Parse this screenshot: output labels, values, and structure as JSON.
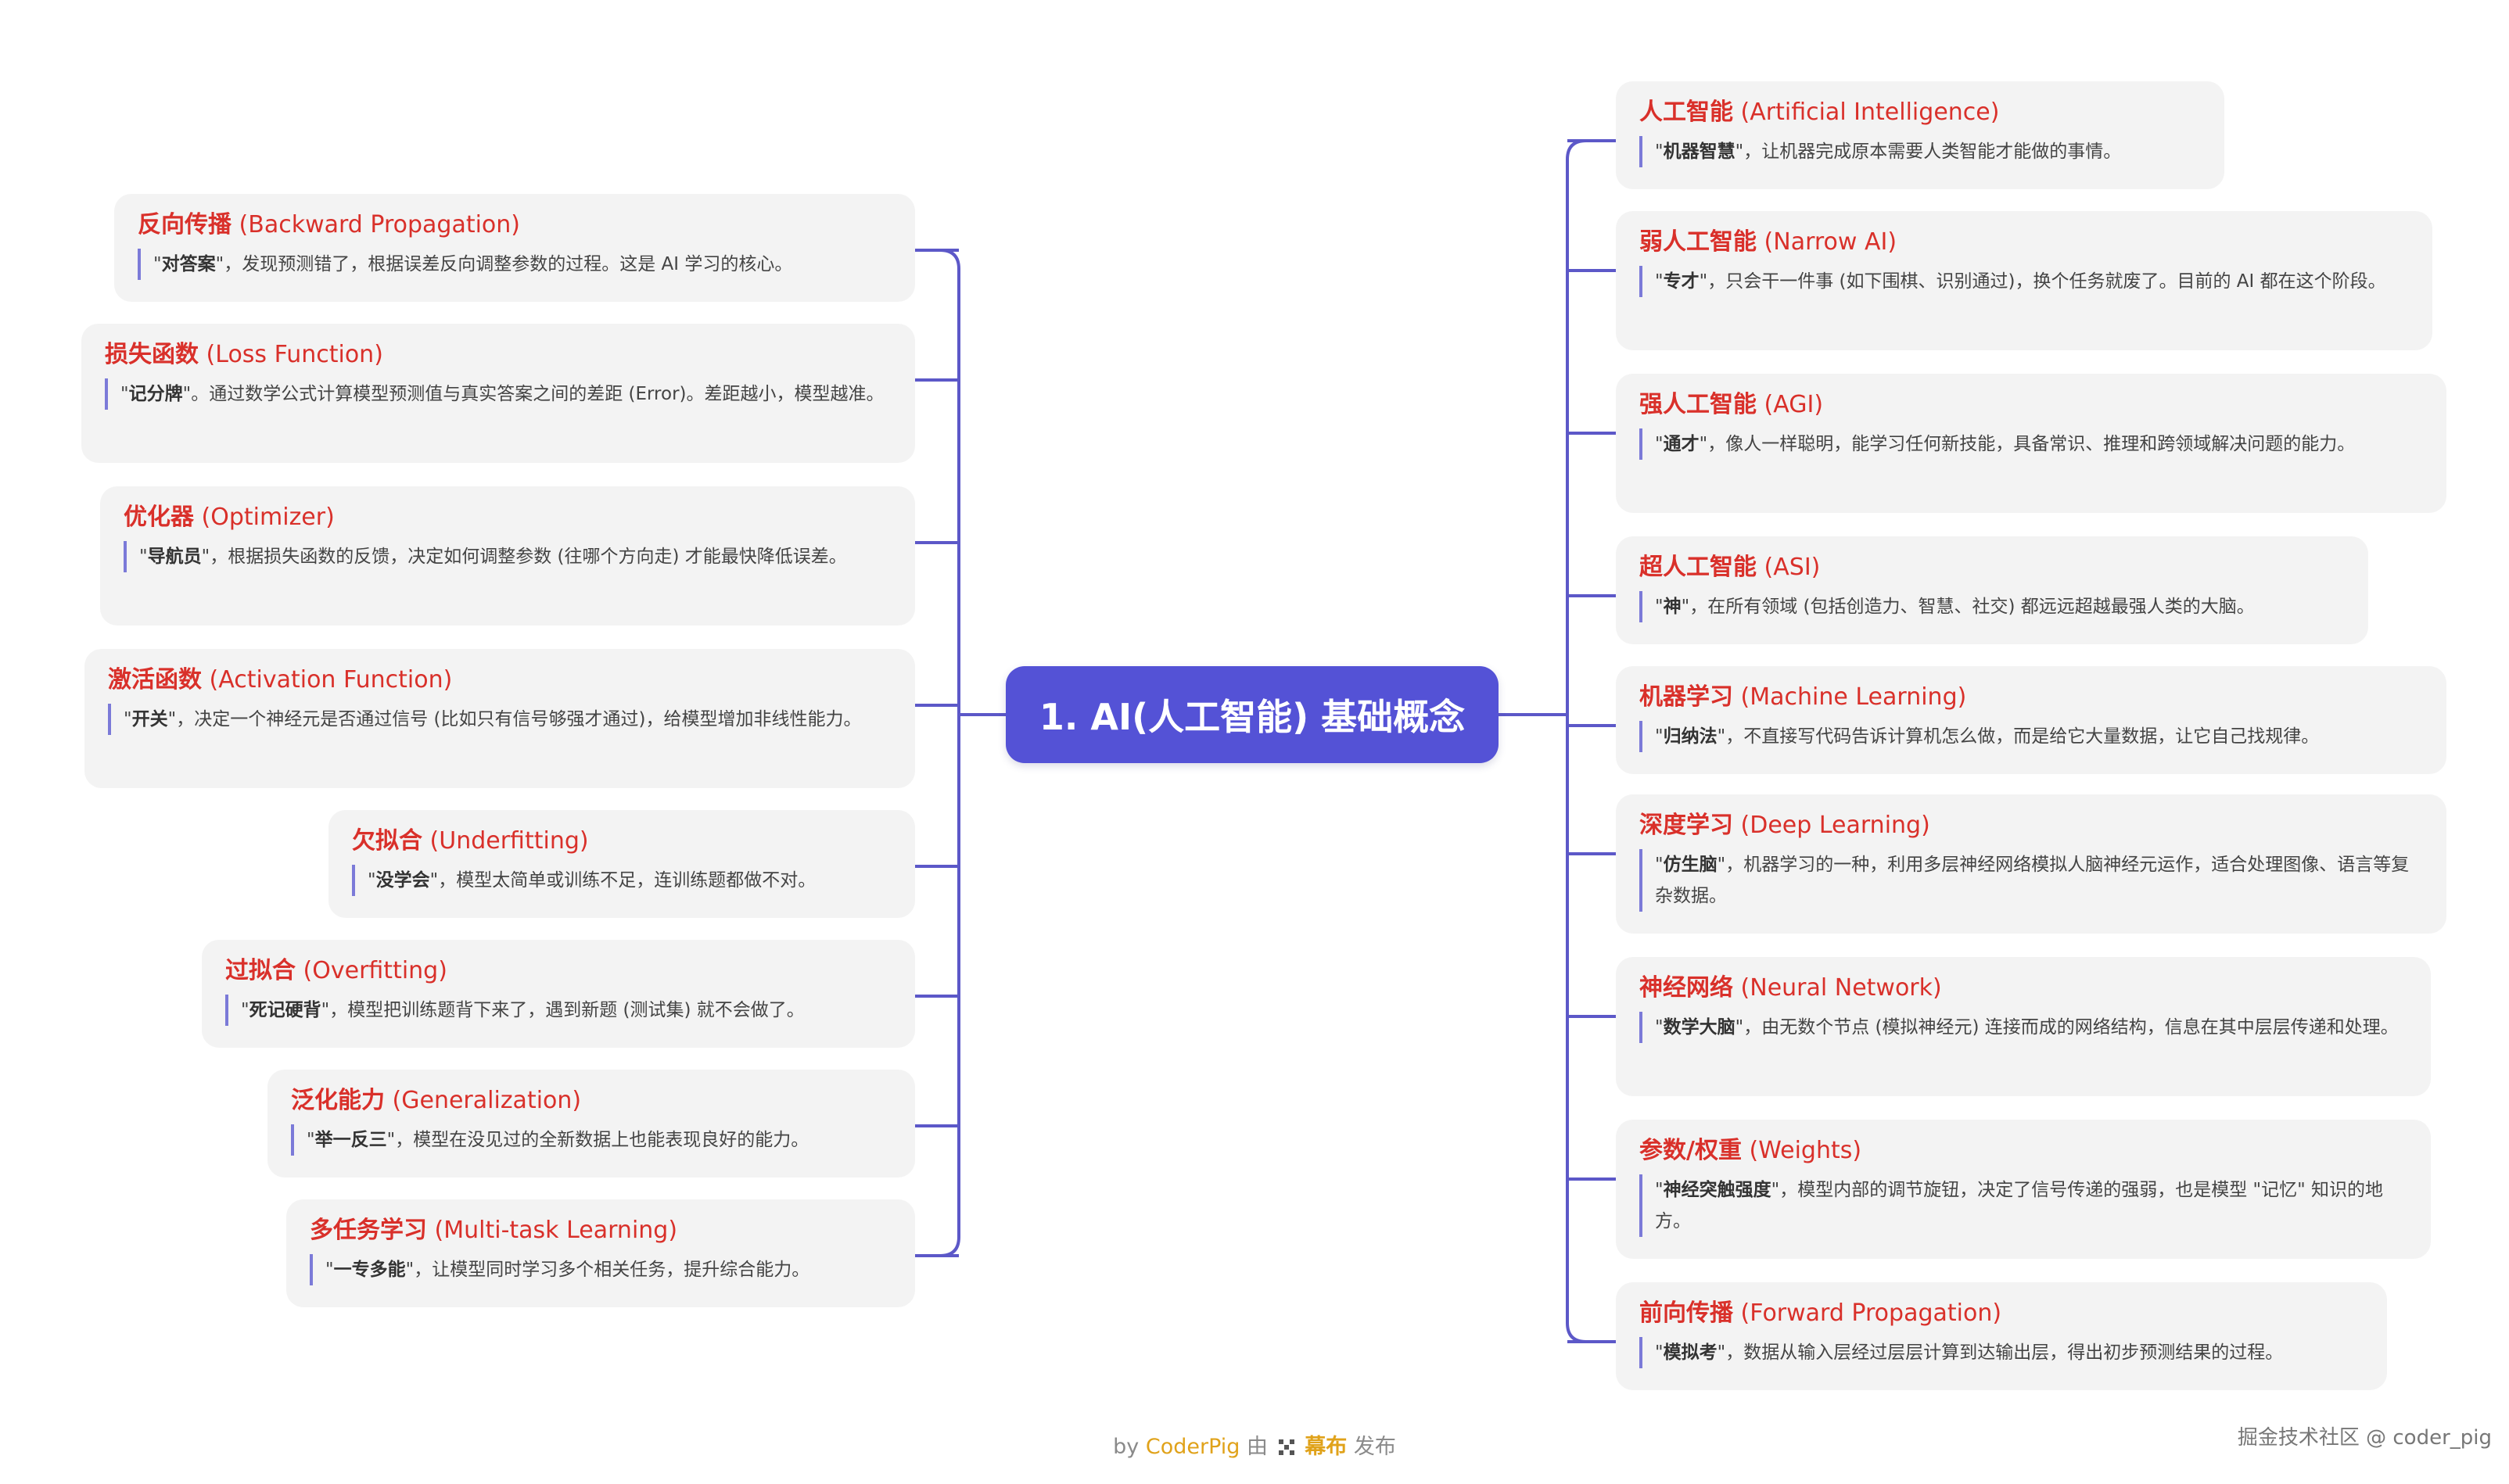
{
  "root": {
    "label": "1. AI(人工智能) 基础概念"
  },
  "right_nodes": [
    {
      "zh": "人工智能",
      "en": "(Artificial Intelligence)",
      "kw": "机器智慧",
      "text": "，让机器完成原本需要人类智能才能做的事情。"
    },
    {
      "zh": "弱人工智能",
      "en": "(Narrow AI)",
      "kw": "专才",
      "text": "，只会干一件事 (如下围棋、识别通过)，换个任务就废了。目前的 AI 都在这个阶段。"
    },
    {
      "zh": "强人工智能",
      "en": "(AGI)",
      "kw": "通才",
      "text": "，像人一样聪明，能学习任何新技能，具备常识、推理和跨领域解决问题的能力。"
    },
    {
      "zh": "超人工智能",
      "en": "(ASI)",
      "kw": "神",
      "text": "，在所有领域 (包括创造力、智慧、社交) 都远远超越最强人类的大脑。"
    },
    {
      "zh": "机器学习",
      "en": "(Machine Learning)",
      "kw": "归纳法",
      "text": "，不直接写代码告诉计算机怎么做，而是给它大量数据，让它自己找规律。"
    },
    {
      "zh": "深度学习",
      "en": "(Deep Learning)",
      "kw": "仿生脑",
      "text": "，机器学习的一种，利用多层神经网络模拟人脑神经元运作，适合处理图像、语言等复杂数据。"
    },
    {
      "zh": "神经网络",
      "en": "(Neural Network)",
      "kw": "数学大脑",
      "text": "，由无数个节点 (模拟神经元) 连接而成的网络结构，信息在其中层层传递和处理。"
    },
    {
      "zh": "参数/权重",
      "en": "(Weights)",
      "kw": "神经突触强度",
      "text": "，模型内部的调节旋钮，决定了信号传递的强弱，也是模型 \"记忆\" 知识的地方。"
    },
    {
      "zh": "前向传播",
      "en": "(Forward Propagation)",
      "kw": "模拟考",
      "text": "，数据从输入层经过层层计算到达输出层，得出初步预测结果的过程。"
    }
  ],
  "left_nodes": [
    {
      "zh": "反向传播",
      "en": "(Backward Propagation)",
      "kw": "对答案",
      "text": "，发现预测错了，根据误差反向调整参数的过程。这是 AI 学习的核心。"
    },
    {
      "zh": "损失函数",
      "en": "(Loss Function)",
      "kw": "记分牌",
      "text": "。通过数学公式计算模型预测值与真实答案之间的差距 (Error)。差距越小，模型越准。"
    },
    {
      "zh": "优化器",
      "en": "(Optimizer)",
      "kw": "导航员",
      "text": "，根据损失函数的反馈，决定如何调整参数 (往哪个方向走) 才能最快降低误差。"
    },
    {
      "zh": "激活函数",
      "en": "(Activation Function)",
      "kw": "开关",
      "text": "，决定一个神经元是否通过信号 (比如只有信号够强才通过)，给模型增加非线性能力。"
    },
    {
      "zh": "欠拟合",
      "en": "(Underfitting)",
      "kw": "没学会",
      "text": "，模型太简单或训练不足，连训练题都做不对。"
    },
    {
      "zh": "过拟合",
      "en": "(Overfitting)",
      "kw": "死记硬背",
      "text": "，模型把训练题背下来了，遇到新题 (测试集) 就不会做了。"
    },
    {
      "zh": "泛化能力",
      "en": "(Generalization)",
      "kw": "举一反三",
      "text": "，模型在没见过的全新数据上也能表现良好的能力。"
    },
    {
      "zh": "多任务学习",
      "en": "(Multi-task Learning)",
      "kw": "一专多能",
      "text": "，让模型同时学习多个相关任务，提升综合能力。"
    }
  ],
  "footer": {
    "prefix": "by",
    "author": "CoderPig",
    "mid": "由",
    "platform": "幕布",
    "suffix": "发布"
  },
  "watermark": "掘金技术社区 @ coder_pig",
  "colors": {
    "root": "#5452d6",
    "line": "#5c58c8",
    "title": "#d9302a",
    "card": "#f3f3f3",
    "accent_bar": "#7b7ad8"
  }
}
